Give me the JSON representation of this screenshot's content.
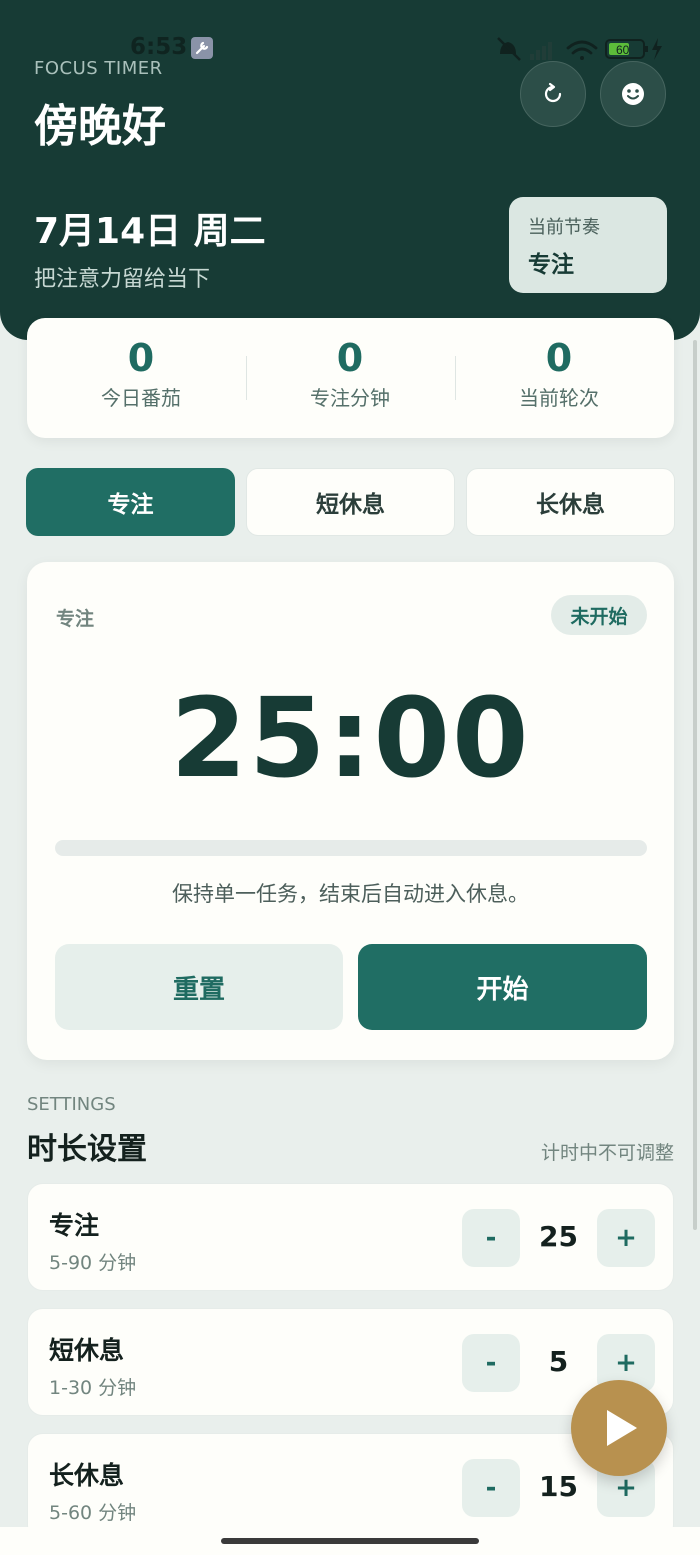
{
  "status_bar": {
    "time": "6:53",
    "battery": "60"
  },
  "header": {
    "eyebrow": "FOCUS TIMER",
    "greeting": "傍晚好",
    "date": "7月14日 周二",
    "subtitle": "把注意力留给当下",
    "rhythm_label": "当前节奏",
    "rhythm_value": "专注"
  },
  "stats": [
    {
      "value": "0",
      "label": "今日番茄"
    },
    {
      "value": "0",
      "label": "专注分钟"
    },
    {
      "value": "0",
      "label": "当前轮次"
    }
  ],
  "tabs": [
    {
      "label": "专注",
      "active": true
    },
    {
      "label": "短休息",
      "active": false
    },
    {
      "label": "长休息",
      "active": false
    }
  ],
  "timer": {
    "mode": "专注",
    "status": "未开始",
    "display": "25:00",
    "progress": 0,
    "hint": "保持单一任务，结束后自动进入休息。",
    "reset_label": "重置",
    "start_label": "开始"
  },
  "settings": {
    "eyebrow": "SETTINGS",
    "title": "时长设置",
    "note": "计时中不可调整",
    "items": [
      {
        "name": "专注",
        "range": "5-90 分钟",
        "value": "25",
        "minus": "-",
        "plus": "+"
      },
      {
        "name": "短休息",
        "range": "1-30 分钟",
        "value": "5",
        "minus": "-",
        "plus": "+"
      },
      {
        "name": "长休息",
        "range": "5-60 分钟",
        "value": "15",
        "minus": "-",
        "plus": "+"
      }
    ]
  },
  "colors": {
    "header_bg": "#173b35",
    "accent": "#206e64",
    "fab": "#b8914f",
    "page_bg": "#e9efec"
  },
  "icons": {
    "refresh": "refresh-icon",
    "face": "face-icon",
    "play": "play-icon"
  }
}
